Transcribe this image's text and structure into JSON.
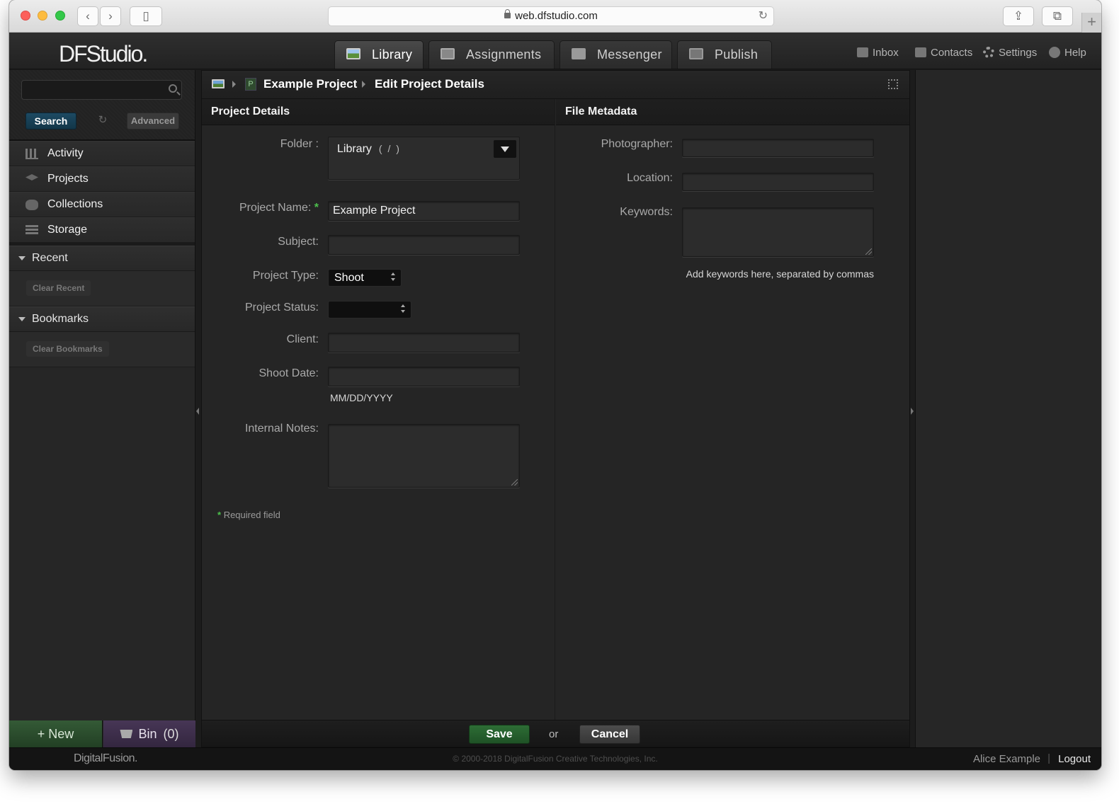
{
  "browser": {
    "url": "web.dfstudio.com"
  },
  "app": {
    "logo": "DFStudio."
  },
  "tabs": [
    {
      "label": "Library",
      "icon": "library-icon"
    },
    {
      "label": "Assignments",
      "icon": "assignments-icon"
    },
    {
      "label": "Messenger",
      "icon": "messenger-icon"
    },
    {
      "label": "Publish",
      "icon": "publish-icon"
    }
  ],
  "utility_links": [
    {
      "label": "Inbox",
      "icon": "inbox-icon"
    },
    {
      "label": "Contacts",
      "icon": "contacts-icon"
    },
    {
      "label": "Settings",
      "icon": "gear-icon"
    },
    {
      "label": "Help",
      "icon": "help-icon"
    }
  ],
  "sidebar": {
    "search": {
      "value": "",
      "placeholder": "",
      "search_label": "Search",
      "advanced_label": "Advanced"
    },
    "nav": [
      {
        "label": "Activity",
        "icon": "activity-icon"
      },
      {
        "label": "Projects",
        "icon": "projects-icon"
      },
      {
        "label": "Collections",
        "icon": "collections-icon"
      },
      {
        "label": "Storage",
        "icon": "storage-icon"
      }
    ],
    "recent": {
      "title": "Recent",
      "clear_label": "Clear Recent"
    },
    "bookmarks": {
      "title": "Bookmarks",
      "clear_label": "Clear Bookmarks"
    },
    "new_label": "New",
    "new_symbol": "+",
    "bin_label": "Bin",
    "bin_count": "0"
  },
  "breadcrumb": {
    "project_letter": "P",
    "project": "Example Project",
    "page": "Edit Project Details"
  },
  "project_details": {
    "title": "Project Details",
    "folder_label": "Folder :",
    "folder_value": "Library",
    "folder_path": "( / )",
    "project_name_label": "Project Name:",
    "required_mark": "*",
    "project_name_value": "Example Project",
    "subject_label": "Subject:",
    "subject_value": "",
    "project_type_label": "Project Type:",
    "project_type_value": "Shoot",
    "project_status_label": "Project Status:",
    "project_status_value": "",
    "client_label": "Client:",
    "client_value": "",
    "shoot_date_label": "Shoot Date:",
    "shoot_date_value": "",
    "shoot_date_hint": "MM/DD/YYYY",
    "internal_notes_label": "Internal Notes:",
    "internal_notes_value": "",
    "required_note": "Required field"
  },
  "file_metadata": {
    "title": "File Metadata",
    "photographer_label": "Photographer:",
    "photographer_value": "",
    "location_label": "Location:",
    "location_value": "",
    "keywords_label": "Keywords:",
    "keywords_value": "",
    "keywords_hint": "Add keywords here, separated by commas"
  },
  "actions": {
    "save_label": "Save",
    "or_label": "or",
    "cancel_label": "Cancel"
  },
  "footer": {
    "logo": "DigitalFusion.",
    "copyright": "© 2000-2018 DigitalFusion Creative Technologies, Inc.",
    "user": "Alice Example",
    "separator": "|",
    "logout_label": "Logout"
  },
  "colors": {
    "save_green": "#2d6d35",
    "search_blue": "#1d4a63",
    "new_green": "#345a36",
    "bin_purple": "#473656",
    "required_green": "#4cc04c"
  }
}
